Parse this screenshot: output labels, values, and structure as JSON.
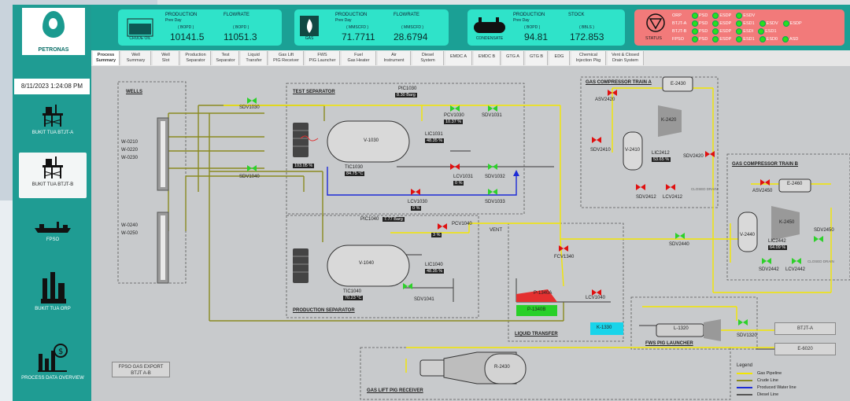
{
  "sidebar": {
    "logo_text": "PETRONAS",
    "datetime": "8/11/2023 1:24:08 PM",
    "items": [
      {
        "label": "BUKIT TUA BTJT-A",
        "icon": "offshore-platform-icon"
      },
      {
        "label": "BUKIT TUA BTJT-B",
        "icon": "offshore-platform-icon"
      },
      {
        "label": "FPSO",
        "icon": "ship-icon"
      },
      {
        "label": "BUKIT TUA ORP",
        "icon": "refinery-icon"
      },
      {
        "label": "PROCESS DATA OVERVIEW",
        "icon": "chart-money-icon"
      }
    ]
  },
  "kpis": {
    "crude": {
      "icon_label": "CRUDE OIL",
      "prod_label": "PRODUCTION",
      "prod_sub": "Prev Day",
      "prod_unit": "( BOPD )",
      "prod_value": "10141.5",
      "flow_label": "FLOWRATE",
      "flow_unit": "( BOPD )",
      "flow_value": "11051.3"
    },
    "gas": {
      "icon_label": "GAS",
      "prod_label": "PRODUCTION",
      "prod_sub": "Prev Day",
      "prod_unit": "( MMSCFD )",
      "prod_value": "71.7711",
      "flow_label": "FLOWRATE",
      "flow_unit": "( MMSCFD )",
      "flow_value": "28.6794"
    },
    "condensate": {
      "icon_label": "CONDENSATE",
      "prod_label": "PRODUCTION",
      "prod_sub": "Prev Day",
      "prod_unit": "( BOPD )",
      "prod_value": "94.81",
      "flow_label": "STOCK",
      "flow_unit": "( BBLS )",
      "flow_value": "172.853"
    }
  },
  "status": {
    "label": "STATUS",
    "rows": [
      {
        "name": "ORP",
        "items": [
          "PSD",
          "ESDP",
          "ESDV"
        ]
      },
      {
        "name": "BTJT-A",
        "items": [
          "PSD",
          "ESDP",
          "ESD1",
          "ESDV",
          "ESDP"
        ]
      },
      {
        "name": "BTJT-B",
        "items": [
          "PSD",
          "ESDP",
          "ESDI",
          "ESD1"
        ]
      },
      {
        "name": "FPSO",
        "items": [
          "PSD",
          "ESDP",
          "ESD1",
          "ESD0",
          "ASD"
        ]
      }
    ]
  },
  "tabs": [
    {
      "line1": "Process",
      "line2": "Summary"
    },
    {
      "line1": "Well",
      "line2": "Summary"
    },
    {
      "line1": "Well",
      "line2": "Slot"
    },
    {
      "line1": "Production",
      "line2": "Separator"
    },
    {
      "line1": "Test",
      "line2": "Separator"
    },
    {
      "line1": "Liquid",
      "line2": "Transfer"
    },
    {
      "line1": "Gas Lift",
      "line2": "PIG Receiver"
    },
    {
      "line1": "FWS",
      "line2": "PIG Launcher"
    },
    {
      "line1": "Fuel",
      "line2": "Gas Heater"
    },
    {
      "line1": "Air",
      "line2": "Instrument"
    },
    {
      "line1": "Diesel",
      "line2": "System"
    },
    {
      "line1": "EMDC A",
      "line2": ""
    },
    {
      "line1": "EMDC B",
      "line2": ""
    },
    {
      "line1": "GTG A",
      "line2": ""
    },
    {
      "line1": "GTG B",
      "line2": ""
    },
    {
      "line1": "EDG",
      "line2": ""
    },
    {
      "line1": "Chemical",
      "line2": "Injection Pkg"
    },
    {
      "line1": "Vent & Closed",
      "line2": "Drain System"
    }
  ],
  "diagram": {
    "wells_title": "WELLS",
    "wells_group1": [
      "W-0210",
      "W-0220",
      "W-0230"
    ],
    "wells_group2": [
      "W-0240",
      "W-0250"
    ],
    "test_sep_title": "TEST SEPARATOR",
    "prod_sep_title": "PRODUCTION SEPARATOR",
    "liquid_transfer_title": "LIQUID TRANSFER",
    "gct_a_title": "GAS COMPRESSOR TRAIN A",
    "gct_b_title": "GAS COMPRESSOR TRAIN B",
    "fws_title": "FWS PIG LAUNCHER",
    "gaslift_title": "GAS LIFT PIG RECEIVER",
    "v1030": "V-1030",
    "v1040": "V-1040",
    "pic1030": "PIC1030",
    "pic1030_val": "8.30 Barg",
    "pcv1030": "PCV1030",
    "pcv1030_val": "10.37 %",
    "sdv1031": "SDV1031",
    "lic1031": "LIC1031",
    "lic1031_val": "48.35 %",
    "tic1030": "TIC1030",
    "tic1030_val": "84.75 °C",
    "ec1030_val": "103.05 %",
    "lcv1031": "LCV1031",
    "lcv1031_val": "0 %",
    "sdv1032": "SDV1032",
    "sdv1033": "SDV1033",
    "lcv1030": "LCV1030",
    "lcv1030_val": "0 %",
    "sdv1030": "SDV1030",
    "sdv1040": "SDV1040",
    "pic1040": "PIC1040",
    "pic1040_val": "7.77 Barg",
    "pcv1040": "PCV1040",
    "pcv1040_val": "3 %",
    "vent": "VENT",
    "lic1040": "LIC1040",
    "lic1040_val": "48.35 %",
    "tic1040": "TIC1040",
    "tic1040_val": "70.23 °C",
    "sdv1041": "SDV1041",
    "fcv1340": "FCV1340",
    "lcv1040": "LCV1040",
    "p1340a": "P-1340A",
    "p1340b": "P-1340B",
    "k1330": "K-1330",
    "l1320": "L-1320",
    "sdv1320": "SDV1320",
    "asv2420": "ASV2420",
    "e2430": "E-2430",
    "k2420": "K-2420",
    "v2410": "V-2410",
    "sdv2410": "SDV2410",
    "lic2412": "LIC2412",
    "lic2412_val": "53.65 %",
    "sdv2420": "SDV2420",
    "sdv2412": "SDV2412",
    "lcv2412": "LCV2412",
    "closed_drain": "CLOSED DRAIN",
    "sdv2440": "SDV2440",
    "asv2450": "ASV2450",
    "e2460": "E-2460",
    "k2450": "K-2450",
    "v2440": "V-2440",
    "lic2442": "LIC2442",
    "lic2442_val": "64.09 %",
    "sdv2450": "SDV2450",
    "sdv2442": "SDV2442",
    "lcv2442": "LCV2442",
    "closed_drain2": "CLOSED DRAIN",
    "btjt_a": "BTJT-A",
    "e6020": "E-6020",
    "fpso_export_l1": "FPSO GAS EXPORT",
    "fpso_export_l2": "BTJT A-B",
    "r2430": "R-2430"
  },
  "legend": {
    "title": "Legend",
    "items": [
      {
        "label": "Gas Pipeline",
        "color": "#f2e600"
      },
      {
        "label": "Crude Line",
        "color": "#8a8a20"
      },
      {
        "label": "Produced Water line",
        "color": "#1c2bd6"
      },
      {
        "label": "Diesel Line",
        "color": "#555555"
      }
    ]
  },
  "colors": {
    "teal": "#1ba095",
    "kpi": "#2fe3c9",
    "status": "#f27a7a",
    "valve_open": "#2dd12a",
    "valve_closed": "#e01010"
  }
}
